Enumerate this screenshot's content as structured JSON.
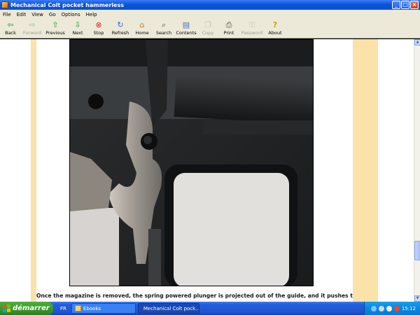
{
  "window": {
    "title": "Mechanical Colt pocket hammerless",
    "buttons": [
      "minimize",
      "maximize",
      "close"
    ]
  },
  "menu": [
    "File",
    "Edit",
    "View",
    "Go",
    "Options",
    "Help"
  ],
  "toolbar": [
    {
      "label": "Back",
      "icon": "arrow-left-icon",
      "enabled": true
    },
    {
      "label": "Forward",
      "icon": "arrow-right-icon",
      "enabled": false
    },
    {
      "label": "Previous",
      "icon": "arrow-up-icon",
      "enabled": true
    },
    {
      "label": "Next",
      "icon": "arrow-down-icon",
      "enabled": true
    },
    {
      "label": "Stop",
      "icon": "stop-icon",
      "enabled": true
    },
    {
      "label": "Refresh",
      "icon": "refresh-icon",
      "enabled": true
    },
    {
      "label": "Home",
      "icon": "home-icon",
      "enabled": true
    },
    {
      "label": "Search",
      "icon": "search-icon",
      "enabled": true
    },
    {
      "label": "Contents",
      "icon": "contents-icon",
      "enabled": true
    },
    {
      "label": "Copy",
      "icon": "copy-icon",
      "enabled": false
    },
    {
      "label": "Print",
      "icon": "print-icon",
      "enabled": true
    },
    {
      "label": "Password",
      "icon": "password-icon",
      "enabled": false
    },
    {
      "label": "About",
      "icon": "about-icon",
      "enabled": true
    }
  ],
  "content": {
    "caption": "Once the magazine is removed, the spring powered plunger is projected out of the guide, and it pushes the magazine"
  },
  "taskbar": {
    "start_label": "démarrer",
    "lang": "FR",
    "tasks": [
      {
        "label": "Ebooks",
        "active": false
      },
      {
        "label": "Mechanical Colt pock...",
        "active": true
      }
    ],
    "clock": "15:12"
  },
  "colors": {
    "accent_band": "#fbe2a8",
    "taskbar_blue": "#245edc",
    "start_green": "#3a962b"
  }
}
